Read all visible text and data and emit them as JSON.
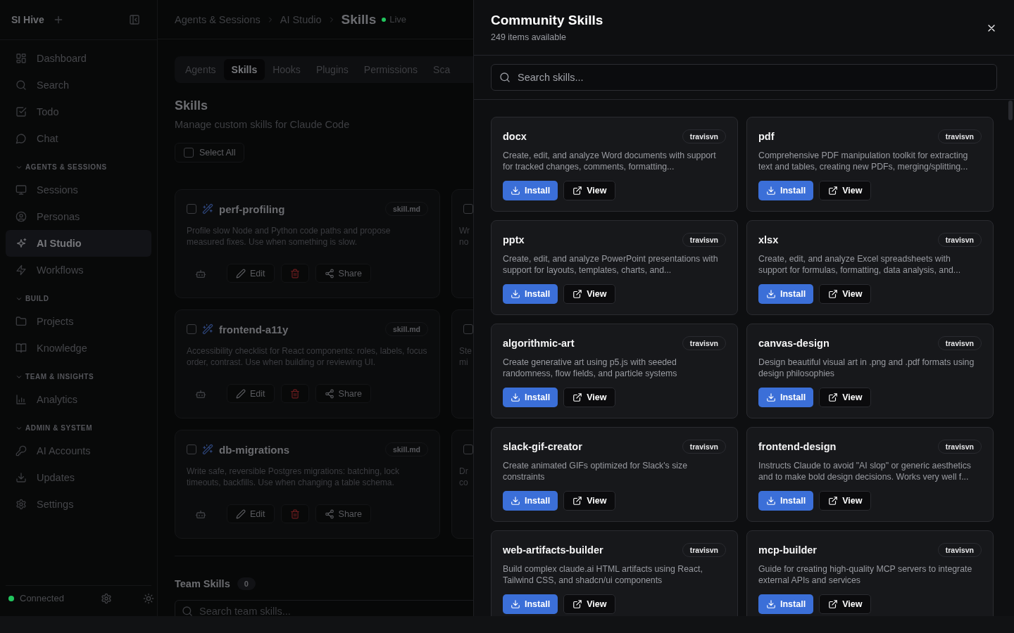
{
  "sidebar": {
    "brand": "SI Hive",
    "groups": [
      {
        "items": [
          {
            "label": "Dashboard",
            "selected": false
          },
          {
            "label": "Search",
            "selected": false
          },
          {
            "label": "Todo",
            "selected": false
          },
          {
            "label": "Chat",
            "selected": false
          }
        ]
      },
      {
        "label": "AGENTS & SESSIONS",
        "expanded": true,
        "items": [
          {
            "label": "Sessions",
            "selected": false
          },
          {
            "label": "Personas",
            "selected": false
          },
          {
            "label": "AI Studio",
            "selected": true
          },
          {
            "label": "Workflows",
            "selected": false
          }
        ]
      },
      {
        "label": "BUILD",
        "expanded": true,
        "items": [
          {
            "label": "Projects",
            "selected": false
          },
          {
            "label": "Knowledge",
            "selected": false
          }
        ]
      },
      {
        "label": "TEAM & INSIGHTS",
        "expanded": true,
        "items": [
          {
            "label": "Analytics",
            "selected": false
          }
        ]
      },
      {
        "label": "ADMIN & SYSTEM",
        "expanded": true,
        "items": [
          {
            "label": "AI Accounts",
            "selected": false
          },
          {
            "label": "Updates",
            "selected": false
          },
          {
            "label": "Settings",
            "selected": false
          }
        ]
      }
    ],
    "status": {
      "label": "Connected",
      "color": "#22c55e"
    }
  },
  "main": {
    "breadcrumb": [
      "Agents & Sessions",
      "AI Studio"
    ],
    "current": "Skills",
    "live": {
      "label": "Live",
      "color": "#22c55e"
    },
    "tabs": [
      {
        "label": "Agents",
        "selected": false
      },
      {
        "label": "Skills",
        "selected": true
      },
      {
        "label": "Hooks",
        "selected": false
      },
      {
        "label": "Plugins",
        "selected": false
      },
      {
        "label": "Permissions",
        "selected": false
      },
      {
        "label": "Sca",
        "selected": false
      }
    ],
    "title": "Skills",
    "subtitle": "Manage custom skills for Claude Code",
    "select_all": {
      "label": "Select All",
      "checked": false
    },
    "skills": [
      {
        "name": "perf-profiling",
        "tag": "skill.md",
        "checked": false,
        "description": "Profile slow Node and Python code paths and propose measured fixes. Use when something is slow.",
        "edit": "Edit",
        "share": "Share"
      },
      {
        "checked": false,
        "partial": [
          "Wr",
          "no"
        ]
      },
      {
        "name": "frontend-a11y",
        "tag": "skill.md",
        "checked": false,
        "description": "Accessibility checklist for React components: roles, labels, focus order, contrast. Use when building or reviewing UI.",
        "edit": "Edit",
        "share": "Share"
      },
      {
        "checked": false,
        "partial": [
          "Ste",
          "mi"
        ]
      },
      {
        "name": "db-migrations",
        "tag": "skill.md",
        "checked": false,
        "description": "Write safe, reversible Postgres migrations: batching, lock timeouts, backfills. Use when changing a table schema.",
        "edit": "Edit",
        "share": "Share"
      },
      {
        "checked": false,
        "partial": [
          "Dr",
          "co"
        ]
      }
    ],
    "team": {
      "title": "Team Skills",
      "count": "0",
      "placeholder": "Search team skills..."
    }
  },
  "drawer": {
    "title": "Community Skills",
    "subtitle": "249 items available",
    "placeholder": "Search skills...",
    "skills": [
      {
        "name": "docx",
        "author": "travisvn",
        "description": "Create, edit, and analyze Word documents with support for tracked changes, comments, formatting...",
        "install": "Install",
        "view": "View"
      },
      {
        "name": "pdf",
        "author": "travisvn",
        "description": "Comprehensive PDF manipulation toolkit for extracting text and tables, creating new PDFs, merging/splitting...",
        "install": "Install",
        "view": "View"
      },
      {
        "name": "pptx",
        "author": "travisvn",
        "description": "Create, edit, and analyze PowerPoint presentations with support for layouts, templates, charts, and...",
        "install": "Install",
        "view": "View"
      },
      {
        "name": "xlsx",
        "author": "travisvn",
        "description": "Create, edit, and analyze Excel spreadsheets with support for formulas, formatting, data analysis, and...",
        "install": "Install",
        "view": "View"
      },
      {
        "name": "algorithmic-art",
        "author": "travisvn",
        "description": "Create generative art using p5.js with seeded randomness, flow fields, and particle systems",
        "install": "Install",
        "view": "View"
      },
      {
        "name": "canvas-design",
        "author": "travisvn",
        "description": "Design beautiful visual art in .png and .pdf formats using design philosophies",
        "install": "Install",
        "view": "View"
      },
      {
        "name": "slack-gif-creator",
        "author": "travisvn",
        "description": "Create animated GIFs optimized for Slack's size constraints",
        "install": "Install",
        "view": "View"
      },
      {
        "name": "frontend-design",
        "author": "travisvn",
        "description": "Instructs Claude to avoid \"AI slop\" or generic aesthetics and to make bold design decisions. Works very well f...",
        "install": "Install",
        "view": "View"
      },
      {
        "name": "web-artifacts-builder",
        "author": "travisvn",
        "description": "Build complex claude.ai HTML artifacts using React, Tailwind CSS, and shadcn/ui components",
        "install": "Install",
        "view": "View"
      },
      {
        "name": "mcp-builder",
        "author": "travisvn",
        "description": "Guide for creating high-quality MCP servers to integrate external APIs and services",
        "install": "Install",
        "view": "View"
      }
    ]
  }
}
